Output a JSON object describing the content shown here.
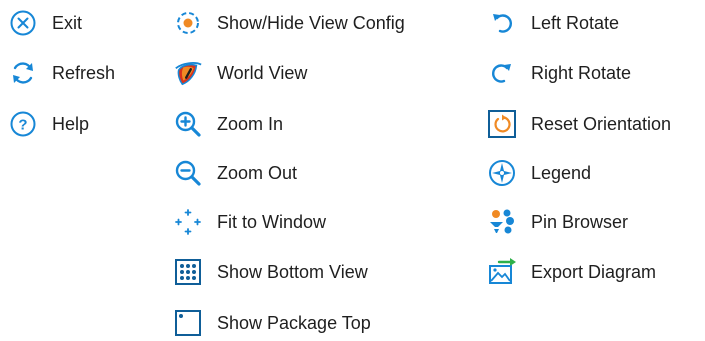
{
  "colors": {
    "blue": "#1787d6",
    "orange": "#f08a24",
    "red": "#d9321c",
    "green": "#2fb04a",
    "dark_blue": "#0f5e98"
  },
  "columns": [
    {
      "items": [
        {
          "label": "Exit",
          "icon": "close-circle-icon"
        },
        {
          "label": "Refresh",
          "icon": "refresh-icon"
        },
        {
          "label": "Help",
          "icon": "help-icon"
        }
      ]
    },
    {
      "items": [
        {
          "label": "Show/Hide View Config",
          "icon": "gear-icon"
        },
        {
          "label": "World View",
          "icon": "eye-icon"
        },
        {
          "label": "Zoom In",
          "icon": "zoom-in-icon"
        },
        {
          "label": "Zoom Out",
          "icon": "zoom-out-icon"
        },
        {
          "label": "Fit to Window",
          "icon": "fit-window-icon"
        },
        {
          "label": "Show Bottom View",
          "icon": "bottom-view-icon"
        },
        {
          "label": "Show Package Top",
          "icon": "package-top-icon"
        }
      ]
    },
    {
      "items": [
        {
          "label": "Left Rotate",
          "icon": "rotate-left-icon"
        },
        {
          "label": "Right Rotate",
          "icon": "rotate-right-icon"
        },
        {
          "label": "Reset Orientation",
          "icon": "reset-orientation-icon"
        },
        {
          "label": "Legend",
          "icon": "legend-icon"
        },
        {
          "label": "Pin Browser",
          "icon": "pin-browser-icon"
        },
        {
          "label": "Export Diagram",
          "icon": "export-diagram-icon"
        }
      ]
    }
  ]
}
